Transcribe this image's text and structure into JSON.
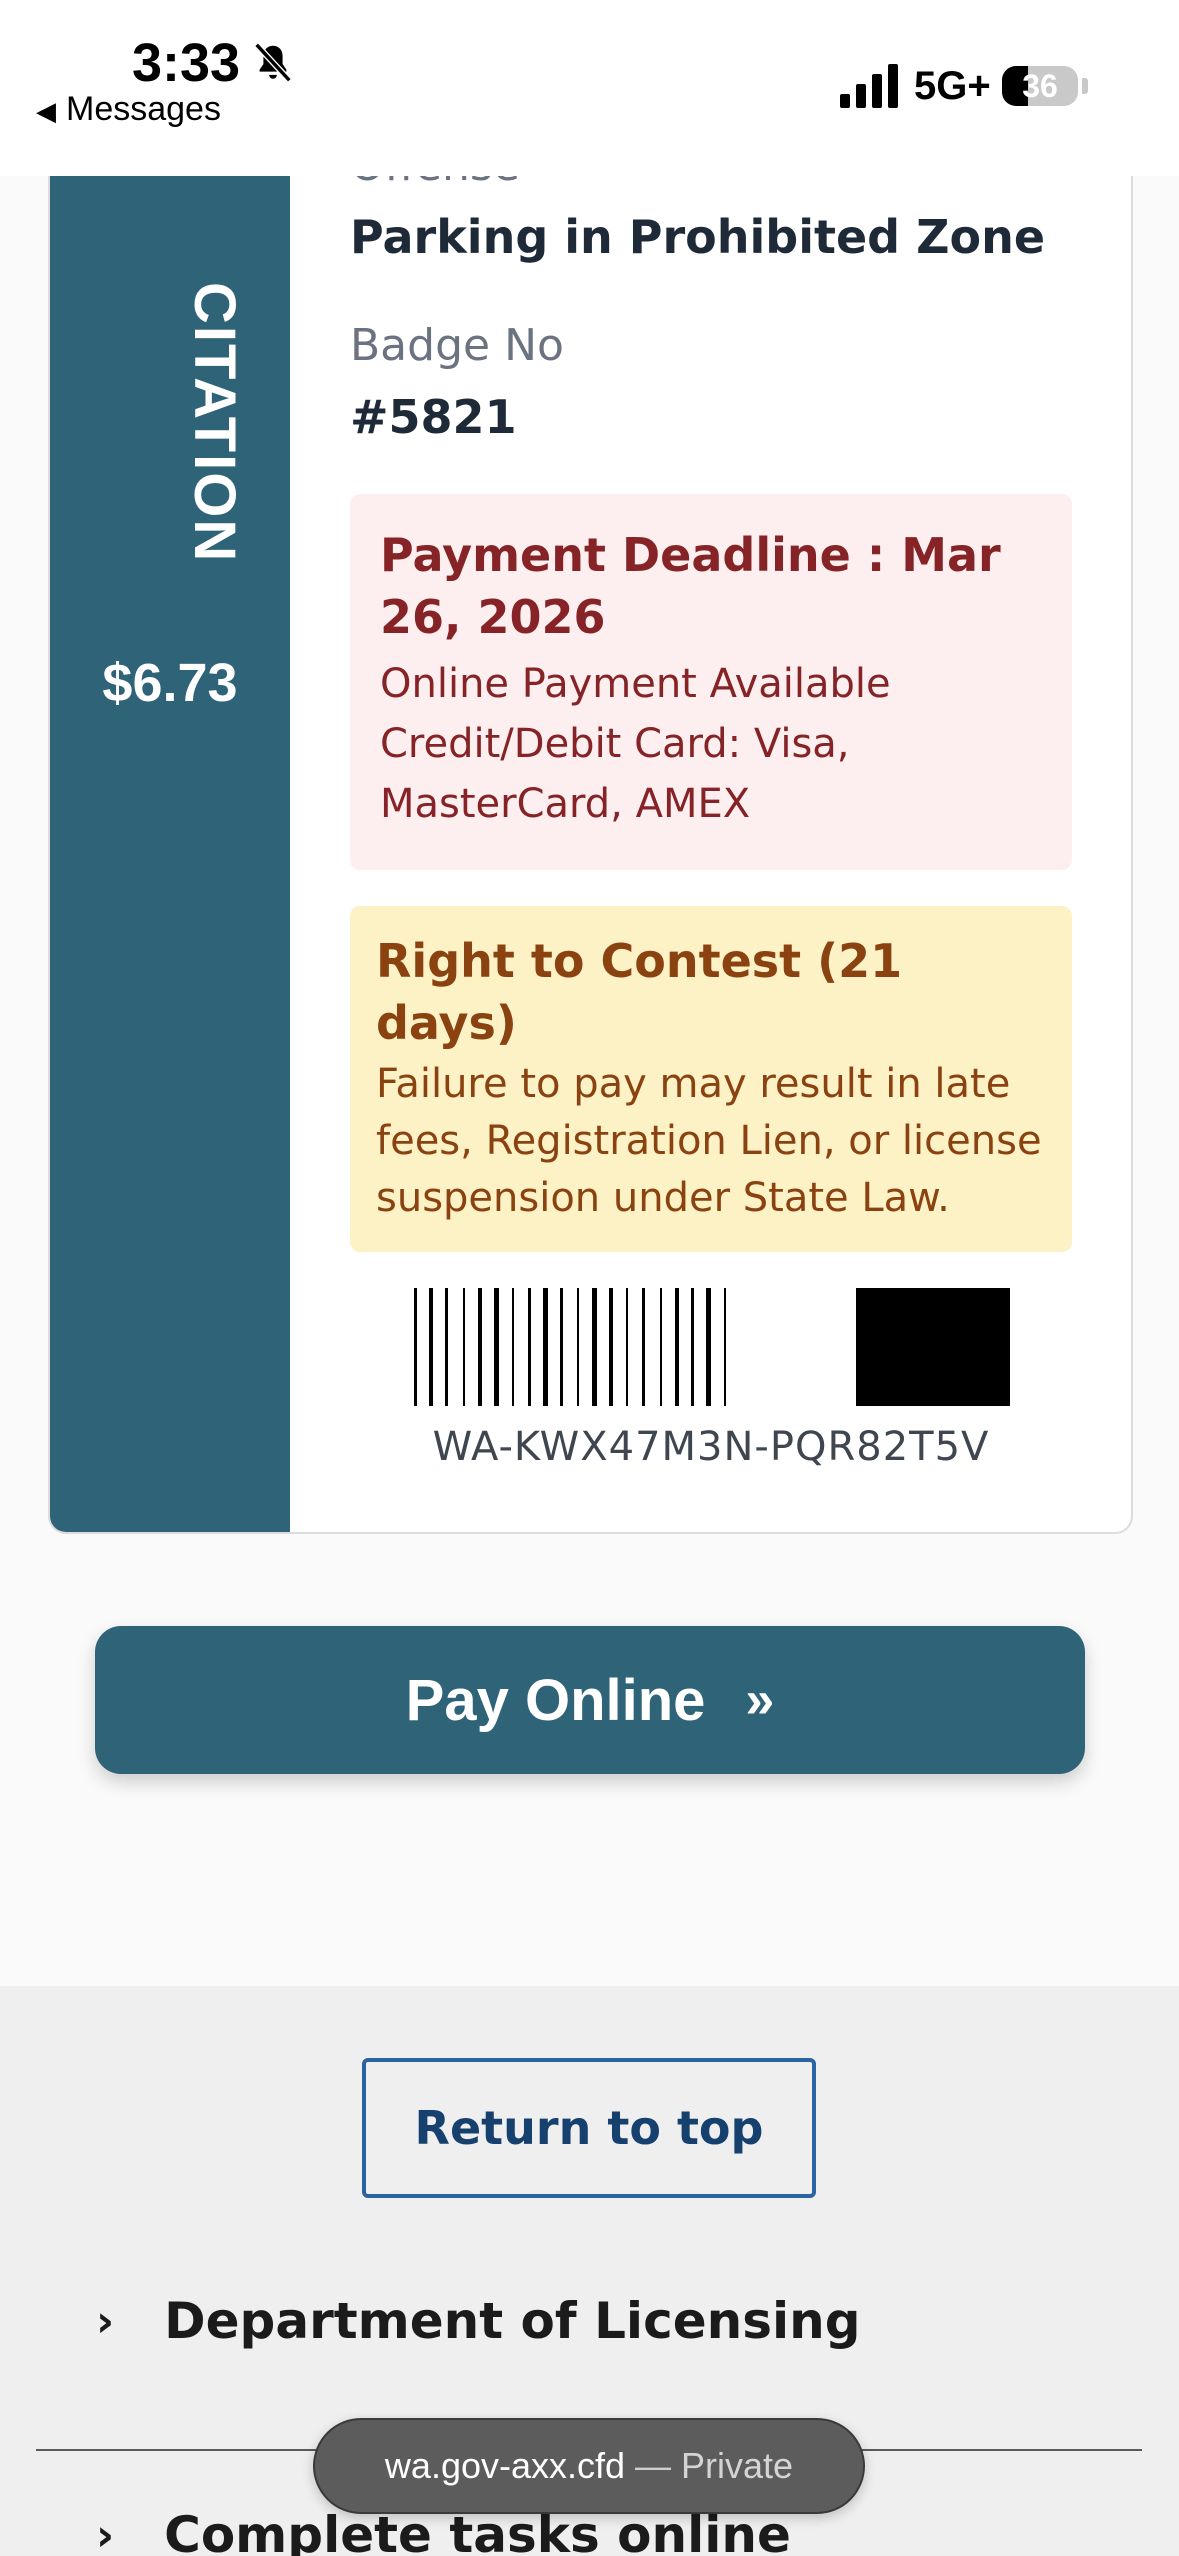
{
  "status_bar": {
    "time": "3:33",
    "back_label": "Messages",
    "network": "5G+",
    "battery_level": "36",
    "icons": [
      "bell-slash-icon",
      "signal-icon",
      "battery-icon"
    ]
  },
  "citation": {
    "stub_label": "CITATION",
    "amount": "$6.73",
    "offense_label": "Offense",
    "offense_value": "Parking in Prohibited Zone",
    "badge_label": "Badge No",
    "badge_value": "#5821",
    "deadline_title": "Payment Deadline : Mar 26, 2026",
    "deadline_lines": [
      "Online Payment Available",
      "Credit/Debit Card: Visa, MasterCard, AMEX"
    ],
    "contest_title": "Right to Contest (21 days)",
    "contest_text": "Failure to pay may result in late fees, Registration Lien, or license suspension under State Law.",
    "barcode_text": "WA-KWX47M3N-PQR82T5V"
  },
  "colors": {
    "stub": "#2f6378",
    "deadline_bg": "#fdeff0",
    "deadline_text": "#862326",
    "contest_bg": "#fdf1c6",
    "contest_text": "#8a4210"
  },
  "actions": {
    "pay_label": "Pay Online",
    "pay_chevron": "»"
  },
  "footer": {
    "return_label": "Return to top",
    "links": [
      "Department of Licensing",
      "Complete tasks online"
    ]
  },
  "browser": {
    "url": "wa.gov-axx.cfd",
    "separator": "—",
    "mode": "Private"
  }
}
